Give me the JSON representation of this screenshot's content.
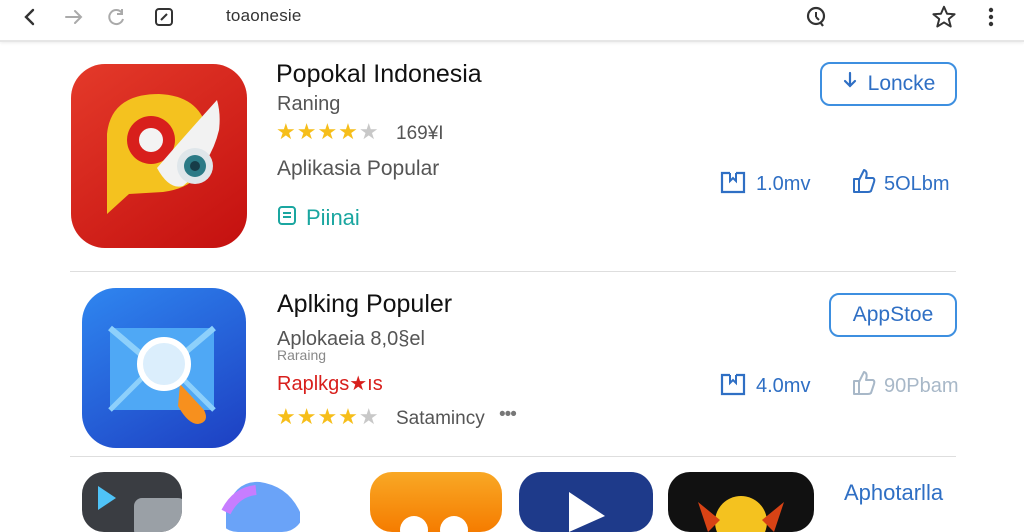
{
  "toolbar": {
    "url": "toaonesie",
    "icons": [
      "back-icon",
      "forward-icon",
      "reload-icon",
      "edit-icon",
      "search-icon",
      "star-icon",
      "more-vert-icon"
    ]
  },
  "apps": [
    {
      "title": "Popokal Indonesia",
      "subtitle": "Raning",
      "rating": 4,
      "rating_count": "169¥I",
      "category": "Aplikasia Popular",
      "badge_label": "Piinai",
      "button_label": "Loncke",
      "stat1": "1.0mv",
      "stat2": "5OLbm",
      "colors": {
        "icon_bg": "#d81f1c",
        "badge": "#1aa6a0"
      }
    },
    {
      "title": "Aplking Populer",
      "subtitle": "Aplokaeia 8,0§el",
      "subtitle2": "Raraing",
      "tag": "Raplkgs★ıs",
      "rating": 4,
      "rating_label": "Satamincy",
      "more": "•••",
      "button_label": "AppStoe",
      "stat1": "4.0mv",
      "stat2": "90Pbam",
      "colors": {
        "icon_bg": "#2563d8",
        "tag": "#d81f1c"
      }
    }
  ],
  "more_link": "Aphotarlla",
  "colors": {
    "accent": "#2f6fc4",
    "star": "#f6be1a"
  }
}
